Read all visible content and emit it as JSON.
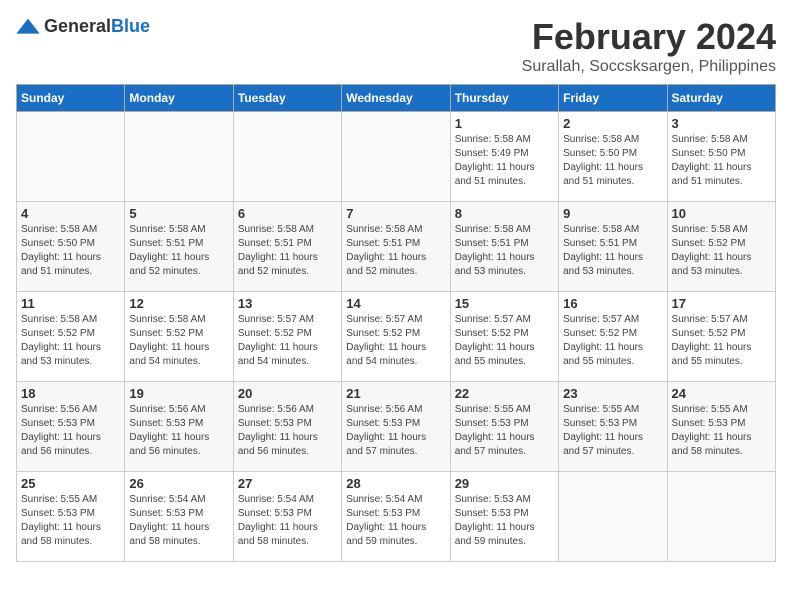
{
  "header": {
    "logo_general": "General",
    "logo_blue": "Blue",
    "title": "February 2024",
    "subtitle": "Surallah, Soccsksargen, Philippines"
  },
  "days_of_week": [
    "Sunday",
    "Monday",
    "Tuesday",
    "Wednesday",
    "Thursday",
    "Friday",
    "Saturday"
  ],
  "weeks": [
    [
      {
        "day": "",
        "info": ""
      },
      {
        "day": "",
        "info": ""
      },
      {
        "day": "",
        "info": ""
      },
      {
        "day": "",
        "info": ""
      },
      {
        "day": "1",
        "info": "Sunrise: 5:58 AM\nSunset: 5:49 PM\nDaylight: 11 hours\nand 51 minutes."
      },
      {
        "day": "2",
        "info": "Sunrise: 5:58 AM\nSunset: 5:50 PM\nDaylight: 11 hours\nand 51 minutes."
      },
      {
        "day": "3",
        "info": "Sunrise: 5:58 AM\nSunset: 5:50 PM\nDaylight: 11 hours\nand 51 minutes."
      }
    ],
    [
      {
        "day": "4",
        "info": "Sunrise: 5:58 AM\nSunset: 5:50 PM\nDaylight: 11 hours\nand 51 minutes."
      },
      {
        "day": "5",
        "info": "Sunrise: 5:58 AM\nSunset: 5:51 PM\nDaylight: 11 hours\nand 52 minutes."
      },
      {
        "day": "6",
        "info": "Sunrise: 5:58 AM\nSunset: 5:51 PM\nDaylight: 11 hours\nand 52 minutes."
      },
      {
        "day": "7",
        "info": "Sunrise: 5:58 AM\nSunset: 5:51 PM\nDaylight: 11 hours\nand 52 minutes."
      },
      {
        "day": "8",
        "info": "Sunrise: 5:58 AM\nSunset: 5:51 PM\nDaylight: 11 hours\nand 53 minutes."
      },
      {
        "day": "9",
        "info": "Sunrise: 5:58 AM\nSunset: 5:51 PM\nDaylight: 11 hours\nand 53 minutes."
      },
      {
        "day": "10",
        "info": "Sunrise: 5:58 AM\nSunset: 5:52 PM\nDaylight: 11 hours\nand 53 minutes."
      }
    ],
    [
      {
        "day": "11",
        "info": "Sunrise: 5:58 AM\nSunset: 5:52 PM\nDaylight: 11 hours\nand 53 minutes."
      },
      {
        "day": "12",
        "info": "Sunrise: 5:58 AM\nSunset: 5:52 PM\nDaylight: 11 hours\nand 54 minutes."
      },
      {
        "day": "13",
        "info": "Sunrise: 5:57 AM\nSunset: 5:52 PM\nDaylight: 11 hours\nand 54 minutes."
      },
      {
        "day": "14",
        "info": "Sunrise: 5:57 AM\nSunset: 5:52 PM\nDaylight: 11 hours\nand 54 minutes."
      },
      {
        "day": "15",
        "info": "Sunrise: 5:57 AM\nSunset: 5:52 PM\nDaylight: 11 hours\nand 55 minutes."
      },
      {
        "day": "16",
        "info": "Sunrise: 5:57 AM\nSunset: 5:52 PM\nDaylight: 11 hours\nand 55 minutes."
      },
      {
        "day": "17",
        "info": "Sunrise: 5:57 AM\nSunset: 5:52 PM\nDaylight: 11 hours\nand 55 minutes."
      }
    ],
    [
      {
        "day": "18",
        "info": "Sunrise: 5:56 AM\nSunset: 5:53 PM\nDaylight: 11 hours\nand 56 minutes."
      },
      {
        "day": "19",
        "info": "Sunrise: 5:56 AM\nSunset: 5:53 PM\nDaylight: 11 hours\nand 56 minutes."
      },
      {
        "day": "20",
        "info": "Sunrise: 5:56 AM\nSunset: 5:53 PM\nDaylight: 11 hours\nand 56 minutes."
      },
      {
        "day": "21",
        "info": "Sunrise: 5:56 AM\nSunset: 5:53 PM\nDaylight: 11 hours\nand 57 minutes."
      },
      {
        "day": "22",
        "info": "Sunrise: 5:55 AM\nSunset: 5:53 PM\nDaylight: 11 hours\nand 57 minutes."
      },
      {
        "day": "23",
        "info": "Sunrise: 5:55 AM\nSunset: 5:53 PM\nDaylight: 11 hours\nand 57 minutes."
      },
      {
        "day": "24",
        "info": "Sunrise: 5:55 AM\nSunset: 5:53 PM\nDaylight: 11 hours\nand 58 minutes."
      }
    ],
    [
      {
        "day": "25",
        "info": "Sunrise: 5:55 AM\nSunset: 5:53 PM\nDaylight: 11 hours\nand 58 minutes."
      },
      {
        "day": "26",
        "info": "Sunrise: 5:54 AM\nSunset: 5:53 PM\nDaylight: 11 hours\nand 58 minutes."
      },
      {
        "day": "27",
        "info": "Sunrise: 5:54 AM\nSunset: 5:53 PM\nDaylight: 11 hours\nand 58 minutes."
      },
      {
        "day": "28",
        "info": "Sunrise: 5:54 AM\nSunset: 5:53 PM\nDaylight: 11 hours\nand 59 minutes."
      },
      {
        "day": "29",
        "info": "Sunrise: 5:53 AM\nSunset: 5:53 PM\nDaylight: 11 hours\nand 59 minutes."
      },
      {
        "day": "",
        "info": ""
      },
      {
        "day": "",
        "info": ""
      }
    ]
  ]
}
